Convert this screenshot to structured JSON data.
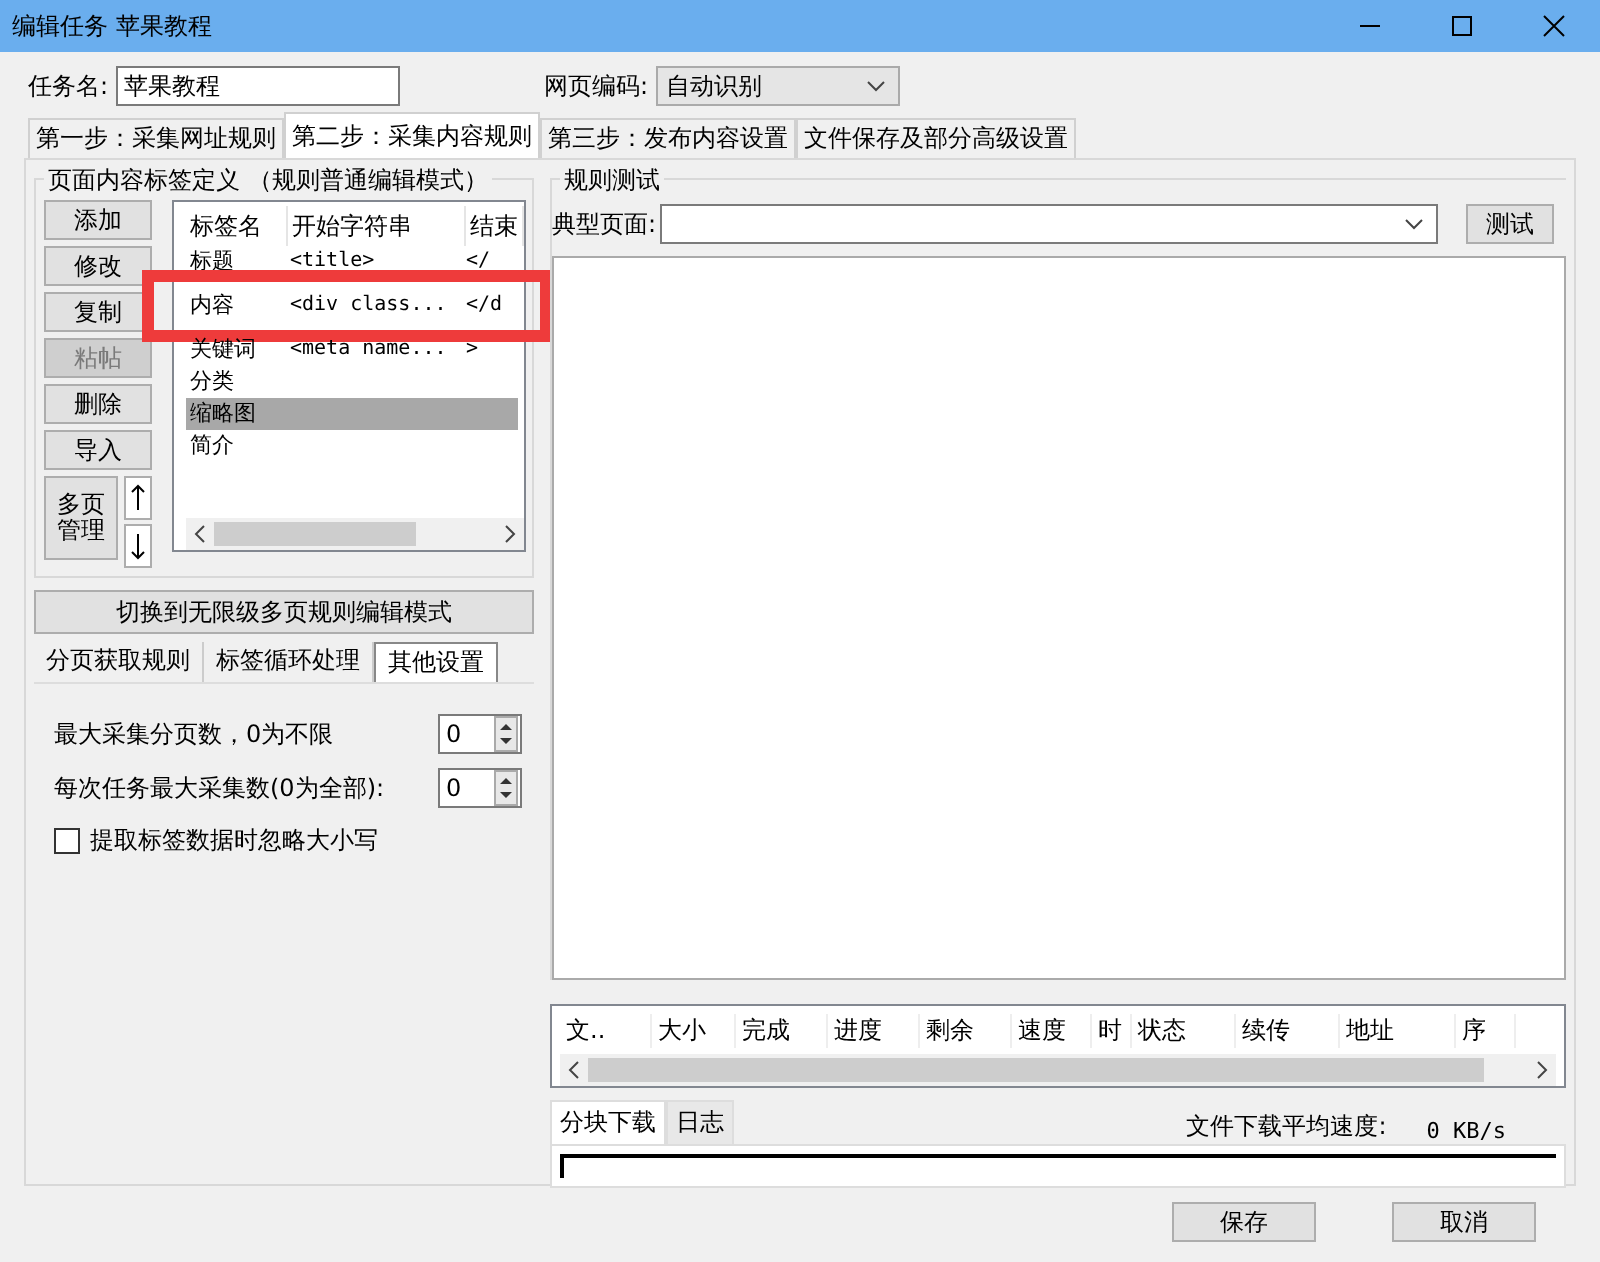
{
  "window": {
    "title": "编辑任务 苹果教程"
  },
  "task_name": {
    "label": "任务名:",
    "value": "苹果教程"
  },
  "encoding": {
    "label": "网页编码:",
    "value": "自动识别"
  },
  "tabs": [
    {
      "label": "第一步：采集网址规则",
      "selected": false
    },
    {
      "label": "第二步：采集内容规则",
      "selected": true
    },
    {
      "label": "第三步：发布内容设置",
      "selected": false
    },
    {
      "label": "文件保存及部分高级设置",
      "selected": false
    }
  ],
  "tag_definition": {
    "title": "页面内容标签定义 （规则普通编辑模式）",
    "buttons": [
      {
        "label": "添加",
        "disabled": false
      },
      {
        "label": "修改",
        "disabled": false
      },
      {
        "label": "复制",
        "disabled": false
      },
      {
        "label": "粘帖",
        "disabled": true
      },
      {
        "label": "删除",
        "disabled": false
      },
      {
        "label": "导入",
        "disabled": false
      }
    ],
    "multipage_button": "多页管理",
    "columns": [
      "标签名",
      "开始字符串",
      "结束"
    ],
    "rows": [
      {
        "cells": [
          "标题",
          "<title>",
          "</"
        ],
        "selected": false,
        "highlighted": false
      },
      {
        "cells": [
          "内容",
          "<div class...",
          "</d"
        ],
        "selected": false,
        "highlighted": true
      },
      {
        "cells": [
          "关键词",
          "<meta name...",
          ">"
        ],
        "selected": false,
        "highlighted": false
      },
      {
        "cells": [
          "分类",
          "",
          ""
        ],
        "selected": false,
        "highlighted": false
      },
      {
        "cells": [
          "缩略图",
          "",
          ""
        ],
        "selected": true,
        "highlighted": false
      },
      {
        "cells": [
          "简介",
          "",
          ""
        ],
        "selected": false,
        "highlighted": false
      }
    ]
  },
  "switch_button": "切换到无限级多页规则编辑模式",
  "sub_tabs": [
    {
      "label": "分页获取规则",
      "selected": false
    },
    {
      "label": "标签循环处理",
      "selected": false
    },
    {
      "label": "其他设置",
      "selected": true
    }
  ],
  "settings": [
    {
      "kind": "spinner",
      "label": "最大采集分页数，0为不限",
      "value": "0"
    },
    {
      "kind": "spinner",
      "label": "每次任务最大采集数(0为全部):",
      "value": "0"
    },
    {
      "kind": "checkbox",
      "label": "提取标签数据时忽略大小写",
      "checked": false
    }
  ],
  "rule_test": {
    "title": "规则测试",
    "page_label": "典型页面:",
    "test_button": "测试"
  },
  "downloads": {
    "columns": [
      "文..",
      "大小",
      "完成",
      "进度",
      "剩余",
      "速度",
      "时",
      "状态",
      "续传",
      "地址",
      "序"
    ]
  },
  "download_tabs": [
    {
      "label": "分块下载",
      "selected": true
    },
    {
      "label": "日志",
      "selected": false
    }
  ],
  "avg_speed": {
    "label": "文件下载平均速度:",
    "value": "0 KB/s"
  },
  "buttons": [
    "保存",
    "取消"
  ]
}
